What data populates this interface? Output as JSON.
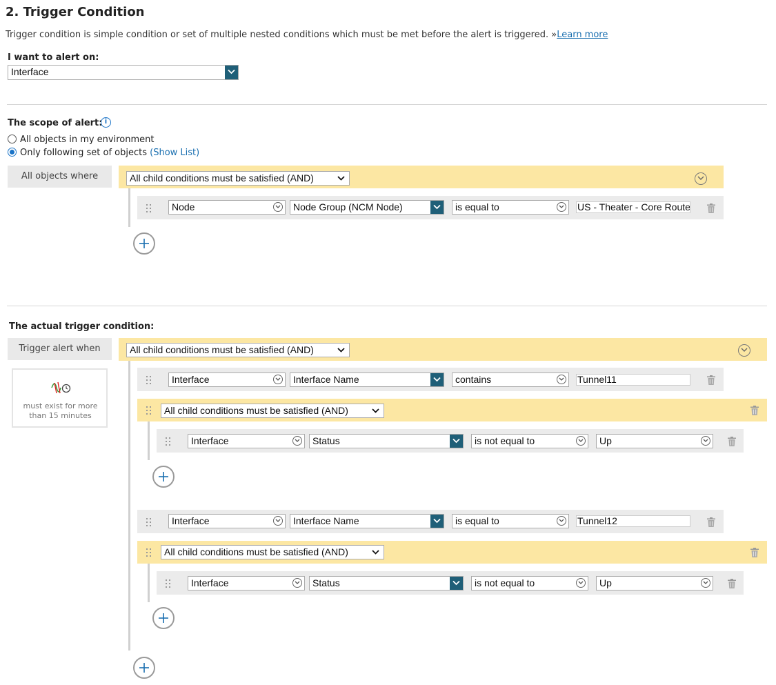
{
  "section": {
    "title": "2. Trigger Condition",
    "description": "Trigger condition is simple condition or set of multiple nested conditions which must be met before the alert is triggered.",
    "learn_more_prefix": "»",
    "learn_more": "Learn more"
  },
  "alert_on": {
    "label": "I want to alert on:",
    "value": "Interface"
  },
  "scope": {
    "label": "The scope of alert:",
    "info_icon": "info-icon",
    "option_all": "All objects in my environment",
    "option_following": "Only following set of objects",
    "show_list": "(Show List)",
    "selected": "following",
    "box_label": "All objects where",
    "group_value": "All child conditions must be satisfied (AND)",
    "condition": {
      "field": "Node",
      "property": "Node Group (NCM Node)",
      "operator": "is equal to",
      "value": "US - Theater - Core Routers"
    }
  },
  "trigger": {
    "label": "The actual trigger condition:",
    "box_label": "Trigger alert when",
    "group_value": "All child conditions must be satisfied (AND)",
    "time_note": "must exist for more than 15 minutes",
    "time_icon": "threshold-time-icon",
    "conditions": [
      {
        "field": "Interface",
        "property": "Interface Name",
        "operator": "contains",
        "value": "Tunnel11"
      },
      {
        "group_value": "All child conditions must be satisfied (AND)",
        "child": {
          "field": "Interface",
          "property": "Status",
          "operator": "is not equal to",
          "value": "Up"
        }
      },
      {
        "field": "Interface",
        "property": "Interface Name",
        "operator": "is equal to",
        "value": "Tunnel12"
      },
      {
        "group_value": "All child conditions must be satisfied (AND)",
        "child": {
          "field": "Interface",
          "property": "Status",
          "operator": "is not equal to",
          "value": "Up"
        }
      }
    ]
  },
  "colors": {
    "group_bar": "#fce7a3",
    "row_bg": "#ebebeb",
    "dropdown_dark": "#1f5f78",
    "link": "#1a6fb0"
  }
}
